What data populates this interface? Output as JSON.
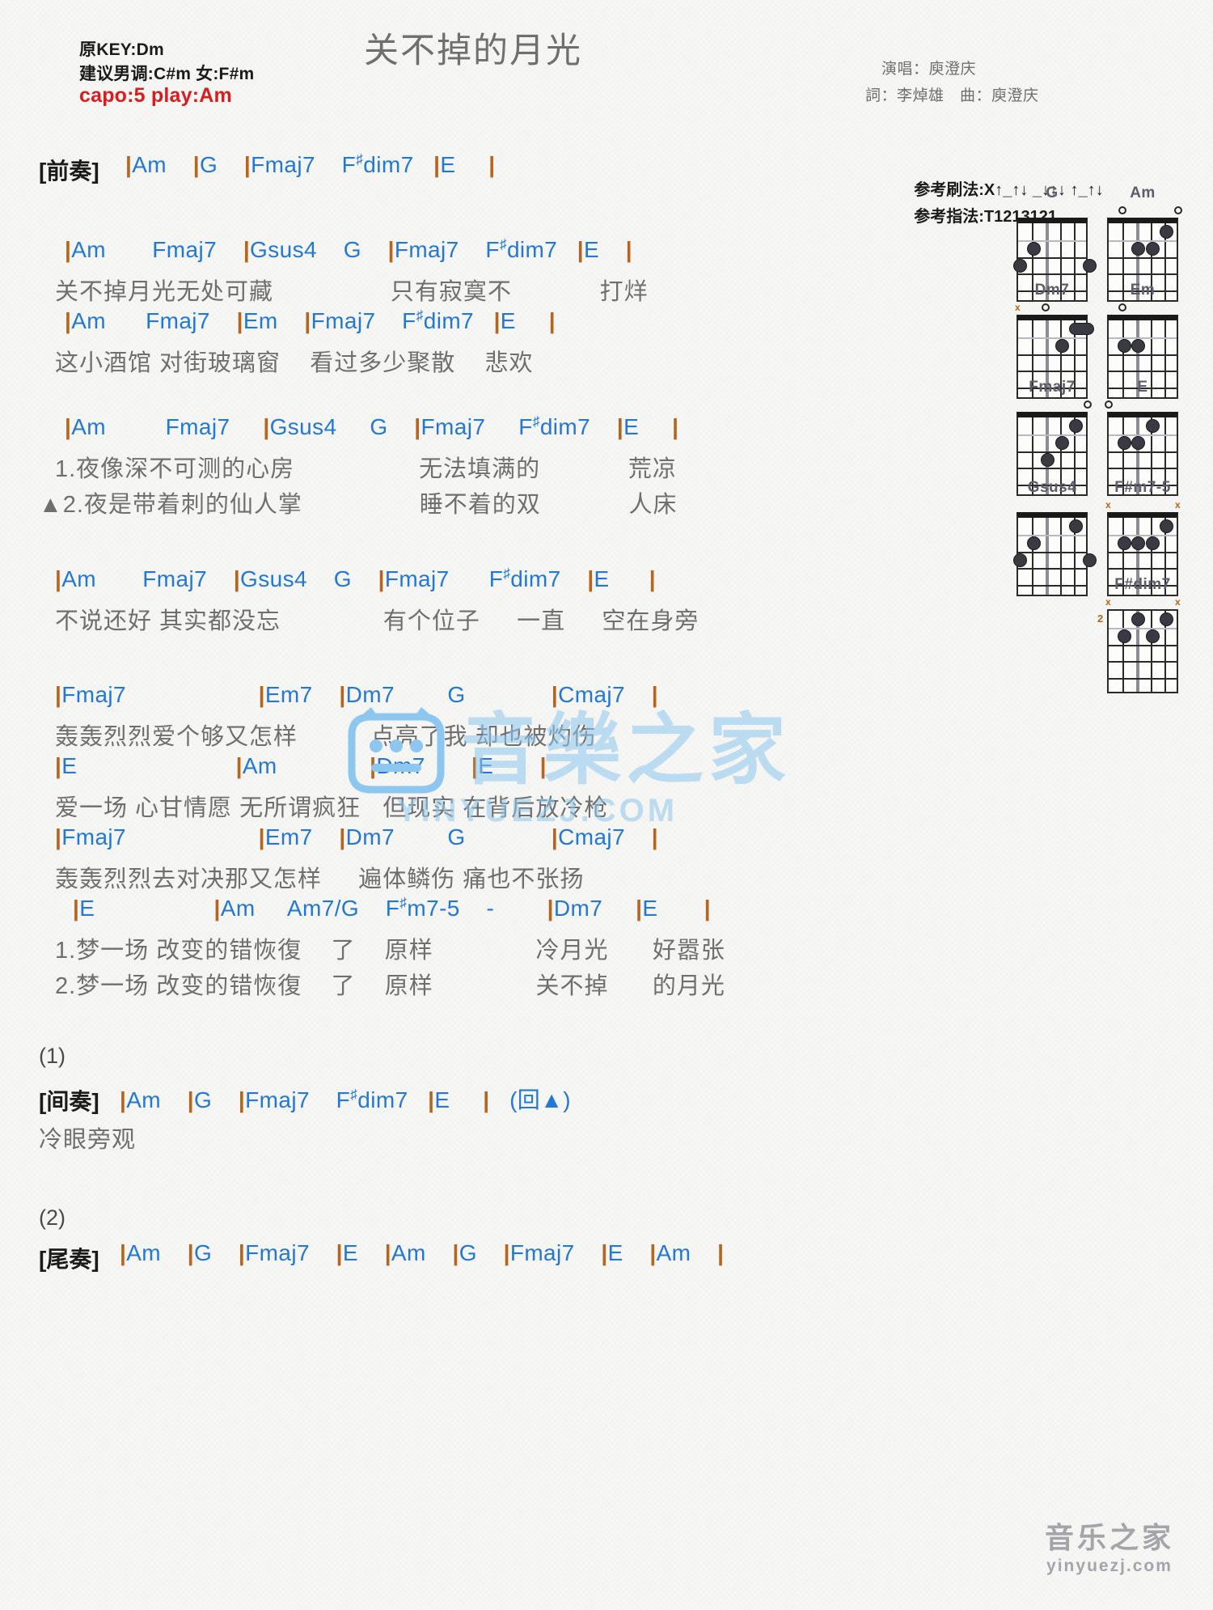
{
  "header": {
    "title": "关不掉的月光",
    "orig_key": "原KEY:Dm",
    "suggest_key": "建议男调:C#m 女:F#m",
    "capo": "capo:5 play:Am",
    "singer": "演唱：庾澄庆",
    "writers": "詞：李焯雄　曲：庾澄庆",
    "strum_label": "参考刷法:X",
    "strum_pattern": "↑_↑↓ _↓↑↓ ↑_↑↓",
    "fingering": "参考指法:T1213121",
    "accent_color": "#2278d4",
    "red_color": "#d81d1d"
  },
  "sections": [
    {
      "tag": "[前奏]",
      "chords": "|Am   |G    |Fmaj7   F#dim7  |E    |"
    }
  ],
  "lines": {
    "intro_tag": "[前奏]",
    "intro_chords": "|Am    |G    |Fmaj7    F#dim7   |E     |",
    "v1a_chords": "|Am       Fmaj7    |Gsus4    G    |Fmaj7    F#dim7   |E    |",
    "v1a_lyrics": "关不掉月光无处可藏                只有寂寞不            打烊",
    "v1b_chords": "|Am      Fmaj7    |Em    |Fmaj7    F#dim7   |E     |",
    "v1b_lyrics": "这小酒馆 对街玻璃窗    看过多少聚散    悲欢",
    "v2a_chords": "|Am         Fmaj7     |Gsus4     G    |Fmaj7     F#dim7    |E     |",
    "v2a_lyrics1": "1.夜像深不可测的心房                 无法填满的            荒凉",
    "v2a_lyrics2": "▲2.夜是带着刺的仙人掌                睡不着的双            人床",
    "v3_chords": "|Am       Fmaj7    |Gsus4    G    |Fmaj7      F#dim7    |E      |",
    "v3_lyrics": "不说还好 其实都没忘              有个位子     一直     空在身旁",
    "c1_chords": "|Fmaj7                    |Em7    |Dm7        G             |Cmaj7    |",
    "c1_lyrics": "轰轰烈烈爱个够又怎样          点亮了我 却也被灼伤",
    "c2_chords": "|E                        |Am              |Dm7       |E       |",
    "c2_lyrics": "爱一场 心甘情愿 无所谓疯狂   但现实 在背后放冷枪",
    "c3_chords": "|Fmaj7                    |Em7    |Dm7        G             |Cmaj7    |",
    "c3_lyrics": "轰轰烈烈去对决那又怎样     遍体鳞伤 痛也不张扬",
    "c4_chords": "|E                  |Am     Am7/G    F#m7-5    -        |Dm7     |E       |",
    "c4_lyrics1": "1.梦一场 改变的错恢復    了    原样              冷月光      好嚣张",
    "c4_lyrics2": "2.梦一场 改变的错恢復    了    原样              关不掉      的月光",
    "mark1": "(1)",
    "interlude_tag": "[间奏]",
    "interlude_chords": "|Am    |G    |Fmaj7    F#dim7   |E     |   (回▲)",
    "interlude_lyrics": "冷眼旁观",
    "mark2": "(2)",
    "outro_tag": "[尾奏]",
    "outro_chords": "|Am    |G    |Fmaj7    |E    |Am    |G    |Fmaj7    |E    |Am    |"
  },
  "chord_diagrams": [
    {
      "name": "G",
      "nut": true,
      "opens": [],
      "muted": [],
      "fretnum": "",
      "dots": [
        {
          "s": 5,
          "f": 2
        },
        {
          "s": 6,
          "f": 3
        },
        {
          "s": 1,
          "f": 3
        }
      ],
      "barre": null
    },
    {
      "name": "Am",
      "nut": true,
      "opens": [
        1,
        5
      ],
      "muted": [],
      "fretnum": "",
      "dots": [
        {
          "s": 4,
          "f": 2
        },
        {
          "s": 3,
          "f": 2
        },
        {
          "s": 2,
          "f": 1
        }
      ],
      "barre": null
    },
    {
      "name": "Dm7",
      "nut": true,
      "opens": [
        4
      ],
      "muted": [
        6
      ],
      "fretnum": "",
      "dots": [
        {
          "s": 3,
          "f": 2
        }
      ],
      "barre": {
        "f": 1,
        "from": 1,
        "to": 2
      }
    },
    {
      "name": "Em",
      "nut": true,
      "opens": [
        5
      ],
      "muted": [],
      "fretnum": "",
      "dots": [
        {
          "s": 5,
          "f": 2
        },
        {
          "s": 4,
          "f": 2
        }
      ],
      "barre": null
    },
    {
      "name": "Fmaj7",
      "nut": true,
      "opens": [
        1
      ],
      "muted": [],
      "fretnum": "",
      "dots": [
        {
          "s": 2,
          "f": 1
        },
        {
          "s": 3,
          "f": 2
        },
        {
          "s": 4,
          "f": 3
        }
      ],
      "barre": null
    },
    {
      "name": "E",
      "nut": true,
      "opens": [
        6
      ],
      "muted": [],
      "fretnum": "",
      "dots": [
        {
          "s": 3,
          "f": 1
        },
        {
          "s": 5,
          "f": 2
        },
        {
          "s": 4,
          "f": 2
        }
      ],
      "barre": null
    },
    {
      "name": "Gsus4",
      "nut": true,
      "opens": [],
      "muted": [],
      "fretnum": "",
      "dots": [
        {
          "s": 2,
          "f": 1
        },
        {
          "s": 5,
          "f": 2
        },
        {
          "s": 6,
          "f": 3
        },
        {
          "s": 1,
          "f": 3
        }
      ],
      "barre": null
    },
    {
      "name": "F#m7-5",
      "nut": true,
      "opens": [],
      "muted": [
        6,
        1
      ],
      "fretnum": "",
      "dots": [
        {
          "s": 2,
          "f": 1
        },
        {
          "s": 5,
          "f": 2
        },
        {
          "s": 4,
          "f": 2
        },
        {
          "s": 3,
          "f": 2
        }
      ],
      "barre": null
    },
    {
      "name": "F#dim7",
      "nut": false,
      "opens": [],
      "muted": [
        6,
        1
      ],
      "fretnum": "2",
      "dots": [
        {
          "s": 4,
          "f": 1
        },
        {
          "s": 2,
          "f": 1
        },
        {
          "s": 5,
          "f": 2
        },
        {
          "s": 3,
          "f": 2
        }
      ],
      "barre": null
    }
  ],
  "watermark": {
    "center_text": "音樂之家",
    "center_sub": "YINYUEZJ.COM",
    "bottom_line1": "音乐之家",
    "bottom_line2": "yinyuezj.com",
    "color": "#8dc7ef"
  }
}
